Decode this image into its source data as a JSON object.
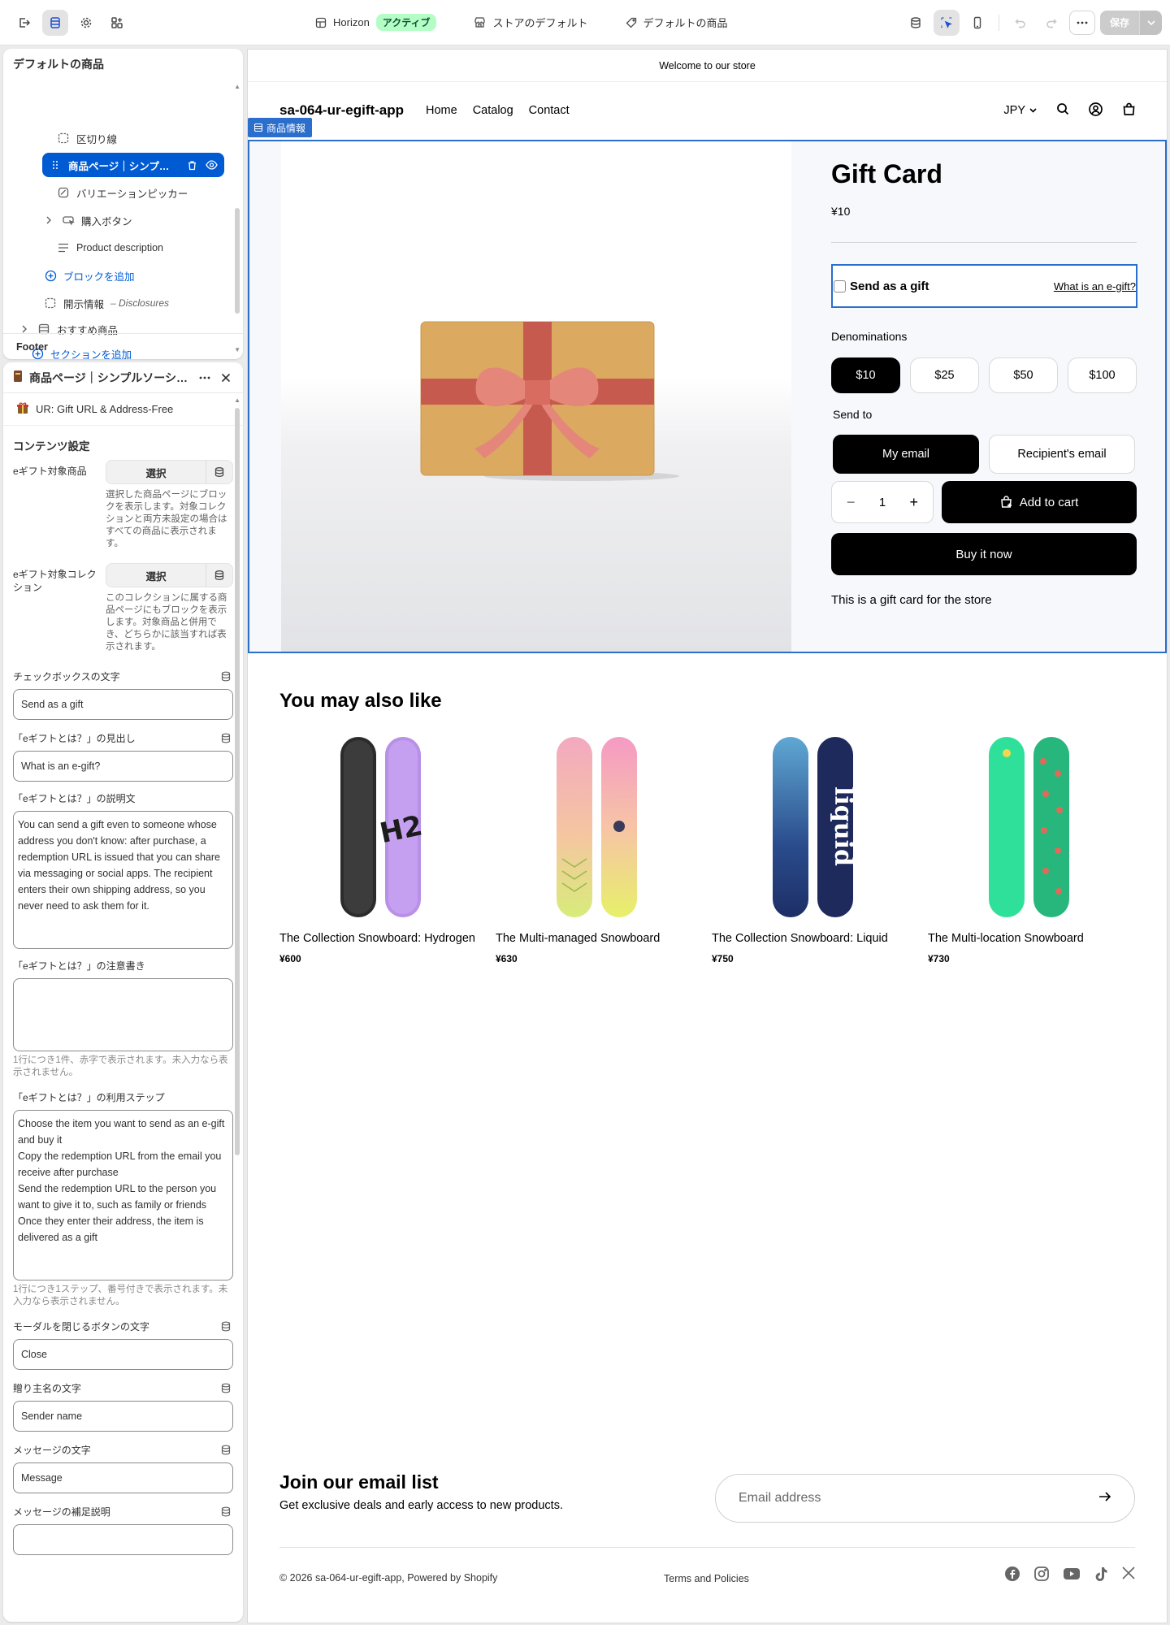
{
  "topbar": {
    "theme_name": "Horizon",
    "theme_status": "アクティブ",
    "store_default": "ストアのデフォルト",
    "product_default": "デフォルトの商品",
    "save_label": "保存"
  },
  "tree": {
    "title": "デフォルトの商品",
    "items": [
      {
        "label": "区切り線"
      },
      {
        "label": "商品ページ｜シンプ…"
      },
      {
        "label": "バリエーションピッカー"
      },
      {
        "label": "購入ボタン"
      },
      {
        "label": "Product description"
      },
      {
        "label": "ブロックを追加"
      },
      {
        "label": "開示情報",
        "sub": "– Disclosures"
      },
      {
        "label": "おすすめ商品"
      },
      {
        "label": "セクションを追加"
      }
    ],
    "footer": "Footer"
  },
  "settings": {
    "title": "商品ページ｜シンプルソーシ…",
    "app_name": "UR: Gift URL & Address-Free",
    "section_title": "コンテンツ設定",
    "egift_product_label": "eギフト対象商品",
    "egift_product_button": "選択",
    "egift_product_help": "選択した商品ページにブロックを表示します。対象コレクションと両方未設定の場合はすべての商品に表示されます。",
    "egift_collection_label": "eギフト対象コレクション",
    "egift_collection_button": "選択",
    "egift_collection_help": "このコレクションに属する商品ページにもブロックを表示します。対象商品と併用でき、どちらかに該当すれば表示されます。",
    "checkbox_text_label": "チェックボックスの文字",
    "checkbox_text_value": "Send as a gift",
    "what_heading_label": "「eギフトとは？」の見出し",
    "what_heading_value": "What is an e-gift?",
    "what_desc_label": "「eギフトとは？」の説明文",
    "what_desc_value": "You can send a gift even to someone whose address you don't know: after purchase, a redemption URL is issued that you can share via messaging or social apps. The recipient enters their own shipping address, so you never need to ask them for it.",
    "what_note_label": "「eギフトとは？」の注意書き",
    "what_note_value": "",
    "what_note_help": "1行につき1件、赤字で表示されます。未入力なら表示されません。",
    "steps_label": "「eギフトとは？」の利用ステップ",
    "steps_value": "Choose the item you want to send as an e-gift and buy it\nCopy the redemption URL from the email you receive after purchase\nSend the redemption URL to the person you want to give it to, such as family or friends\nOnce they enter their address, the item is delivered as a gift",
    "steps_help": "1行につき1ステップ、番号付きで表示されます。未入力なら表示されません。",
    "close_label": "モーダルを閉じるボタンの文字",
    "close_value": "Close",
    "sender_label": "贈り主名の文字",
    "sender_value": "Sender name",
    "message_label": "メッセージの文字",
    "message_value": "Message",
    "message_help_label": "メッセージの補足説明",
    "message_help_value": ""
  },
  "store": {
    "announcement": "Welcome to our store",
    "logo": "sa-064-ur-egift-app",
    "nav": [
      "Home",
      "Catalog",
      "Contact"
    ],
    "currency": "JPY",
    "section_tag": "商品情報",
    "product": {
      "title": "Gift Card",
      "price": "¥10",
      "gift_checkbox": "Send as a gift",
      "gift_link": "What is an e-gift?",
      "denominations_label": "Denominations",
      "denominations": [
        "$10",
        "$25",
        "$50",
        "$100"
      ],
      "selected_denomination": "$10",
      "send_to_label": "Send to",
      "send_to": [
        "My email",
        "Recipient's email"
      ],
      "quantity": "1",
      "add_to_cart": "Add to cart",
      "buy_now": "Buy it now",
      "description": "This is a gift card for the store"
    },
    "also_like_title": "You may also like",
    "related": [
      {
        "name": "The Collection Snowboard: Hydrogen",
        "price": "¥600"
      },
      {
        "name": "The Multi-managed Snowboard",
        "price": "¥630"
      },
      {
        "name": "The Collection Snowboard: Liquid",
        "price": "¥750"
      },
      {
        "name": "The Multi-location Snowboard",
        "price": "¥730"
      }
    ],
    "newsletter_title": "Join our email list",
    "newsletter_sub": "Get exclusive deals and early access to new products.",
    "email_placeholder": "Email address",
    "copyright": "© 2026 sa-064-ur-egift-app, Powered by Shopify",
    "terms": "Terms and Policies"
  },
  "colors": {
    "accent": "#005bd3",
    "selection_border": "#2c6ecb",
    "active_badge": "#b4fec6"
  }
}
